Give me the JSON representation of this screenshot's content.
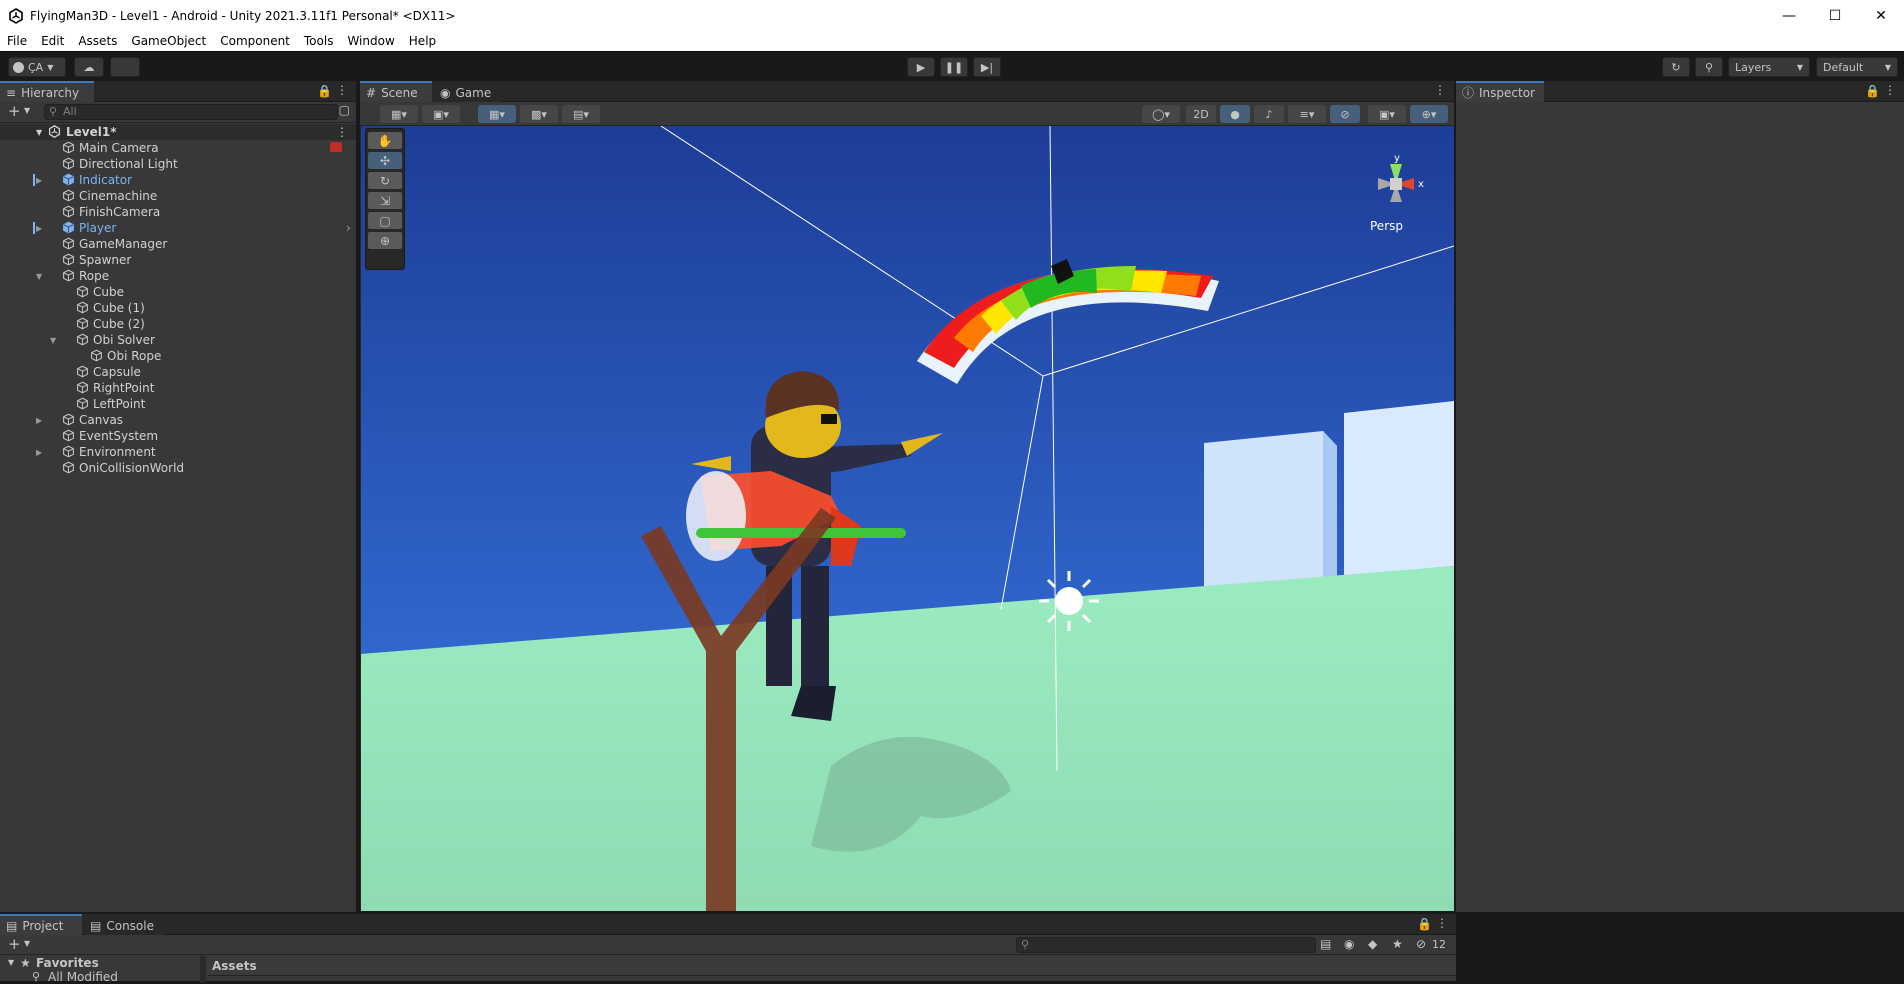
{
  "window": {
    "title": "FlyingMan3D - Level1 - Android - Unity 2021.3.11f1 Personal* <DX11>"
  },
  "menu": [
    "File",
    "Edit",
    "Assets",
    "GameObject",
    "Component",
    "Tools",
    "Window",
    "Help"
  ],
  "toolbar": {
    "account_label": "ÇA",
    "layers_label": "Layers",
    "layout_label": "Default"
  },
  "hierarchy": {
    "tab_label": "Hierarchy",
    "search_placeholder": "All",
    "scene_name": "Level1*",
    "items": [
      {
        "label": "Main Camera",
        "depth": 1,
        "expandable": false,
        "blue": false
      },
      {
        "label": "Directional Light",
        "depth": 1,
        "expandable": false,
        "blue": false
      },
      {
        "label": "Indicator",
        "depth": 1,
        "expandable": true,
        "blue": true
      },
      {
        "label": "Cinemachine",
        "depth": 1,
        "expandable": false,
        "blue": false
      },
      {
        "label": "FinishCamera",
        "depth": 1,
        "expandable": false,
        "blue": false
      },
      {
        "label": "Player",
        "depth": 1,
        "expandable": true,
        "blue": true
      },
      {
        "label": "GameManager",
        "depth": 1,
        "expandable": false,
        "blue": false
      },
      {
        "label": "Spawner",
        "depth": 1,
        "expandable": false,
        "blue": false
      },
      {
        "label": "Rope",
        "depth": 1,
        "expandable": true,
        "blue": false
      },
      {
        "label": "Cube",
        "depth": 2,
        "expandable": false,
        "blue": false
      },
      {
        "label": "Cube (1)",
        "depth": 2,
        "expandable": false,
        "blue": false
      },
      {
        "label": "Cube (2)",
        "depth": 2,
        "expandable": false,
        "blue": false
      },
      {
        "label": "Obi Solver",
        "depth": 2,
        "expandable": true,
        "blue": false
      },
      {
        "label": "Obi Rope",
        "depth": 3,
        "expandable": false,
        "blue": false
      },
      {
        "label": "Capsule",
        "depth": 2,
        "expandable": false,
        "blue": false
      },
      {
        "label": "RightPoint",
        "depth": 2,
        "expandable": false,
        "blue": false
      },
      {
        "label": "LeftPoint",
        "depth": 2,
        "expandable": false,
        "blue": false
      },
      {
        "label": "Canvas",
        "depth": 1,
        "expandable": true,
        "blue": false
      },
      {
        "label": "EventSystem",
        "depth": 1,
        "expandable": false,
        "blue": false
      },
      {
        "label": "Environment",
        "depth": 1,
        "expandable": true,
        "blue": false
      },
      {
        "label": "OniCollisionWorld",
        "depth": 1,
        "expandable": false,
        "blue": false
      }
    ]
  },
  "scene": {
    "tabs": {
      "scene": "Scene",
      "game": "Game"
    },
    "btn_2d": "2D",
    "persp_label": "Persp",
    "gizmo_y": "y",
    "gizmo_x": "x"
  },
  "inspector": {
    "tab_label": "Inspector"
  },
  "project": {
    "tab_project": "Project",
    "tab_console": "Console",
    "favorites": "Favorites",
    "all_modified": "All Modified",
    "assets": "Assets",
    "hidden_count": "12"
  },
  "colors": {
    "accent": "#3a79bb",
    "selected_blue": "#7cb3f0",
    "panel": "#383838",
    "sky_top": "#1d3d97",
    "sky_bottom": "#3b7be8",
    "ground": "#9bebc1"
  }
}
